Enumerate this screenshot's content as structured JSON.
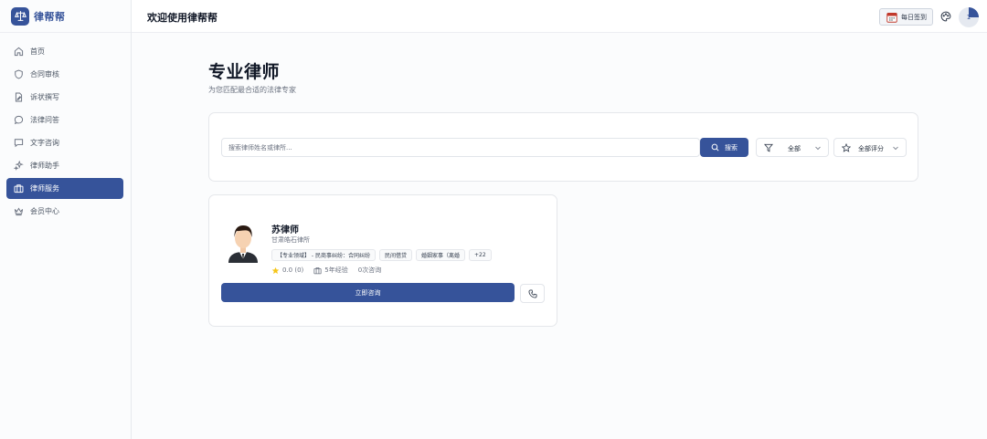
{
  "brand": {
    "name": "律帮帮",
    "logo_icon": "scales-icon",
    "accent": "#36539a"
  },
  "sidebar": {
    "items": [
      {
        "label": "首页",
        "icon": "home-icon"
      },
      {
        "label": "合同审核",
        "icon": "shield-icon"
      },
      {
        "label": "诉状撰写",
        "icon": "file-edit-icon"
      },
      {
        "label": "法律问答",
        "icon": "chat-bubble-icon"
      },
      {
        "label": "文字咨询",
        "icon": "message-square-icon"
      },
      {
        "label": "律师助手",
        "icon": "sparkles-icon"
      },
      {
        "label": "律师服务",
        "icon": "briefcase-icon",
        "active": true
      },
      {
        "label": "会员中心",
        "icon": "crown-icon"
      }
    ]
  },
  "header": {
    "title": "欢迎使用律帮帮",
    "checkin_label": "每日签到",
    "checkin_icon": "calendar-icon",
    "palette_icon": "palette-icon",
    "avatar_text": "1"
  },
  "page": {
    "title": "专业律师",
    "subtitle": "为您匹配最合适的法律专家"
  },
  "search": {
    "placeholder": "搜索律师姓名或律所...",
    "button_label": "搜索",
    "filter_area": "全部",
    "filter_rating": "全部评分"
  },
  "lawyers": [
    {
      "name": "苏律师",
      "firm": "甘肃皓石律所",
      "tags": [
        "【专业领域】 - 民商事纠纷：合同纠纷",
        "民间借贷",
        "婚姻家事（离婚",
        "+22"
      ],
      "rating": "0.0 (0)",
      "experience": "5年经验",
      "consultations": "0次咨询",
      "consult_label": "立即咨询",
      "star_color": "#f5c518"
    }
  ]
}
